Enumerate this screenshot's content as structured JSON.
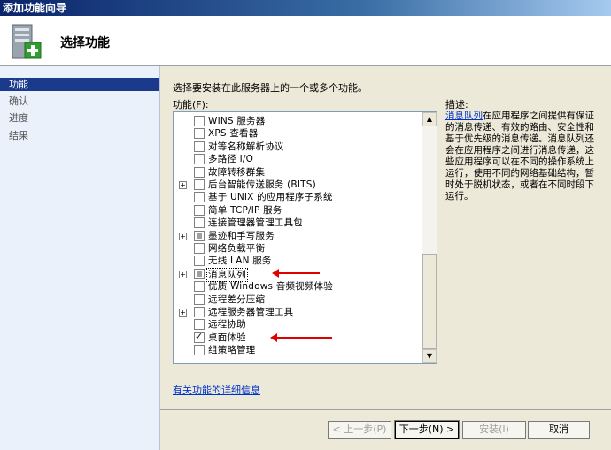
{
  "window": {
    "title": "添加功能向导"
  },
  "header": {
    "title": "选择功能"
  },
  "nav": {
    "items": [
      "功能",
      "确认",
      "进度",
      "结果"
    ]
  },
  "main": {
    "instruction": "选择要安装在此服务器上的一个或多个功能。",
    "features_label": "功能(F):",
    "features": [
      {
        "label": "WINS 服务器",
        "expander": "",
        "check": "none"
      },
      {
        "label": "XPS 查看器",
        "expander": "",
        "check": "none"
      },
      {
        "label": "对等名称解析协议",
        "expander": "",
        "check": "none"
      },
      {
        "label": "多路径 I/O",
        "expander": "",
        "check": "none"
      },
      {
        "label": "故障转移群集",
        "expander": "",
        "check": "none"
      },
      {
        "label": "后台智能传送服务 (BITS)",
        "expander": "+",
        "check": "none"
      },
      {
        "label": "基于 UNIX 的应用程序子系统",
        "expander": "",
        "check": "none"
      },
      {
        "label": "简单 TCP/IP 服务",
        "expander": "",
        "check": "none"
      },
      {
        "label": "连接管理器管理工具包",
        "expander": "",
        "check": "none"
      },
      {
        "label": "墨迹和手写服务",
        "expander": "+",
        "check": "partial"
      },
      {
        "label": "网络负载平衡",
        "expander": "",
        "check": "none"
      },
      {
        "label": "无线 LAN 服务",
        "expander": "",
        "check": "none"
      },
      {
        "label": "消息队列",
        "expander": "+",
        "check": "partial"
      },
      {
        "label": "优质 Windows 音频视频体验",
        "expander": "",
        "check": "none"
      },
      {
        "label": "远程差分压缩",
        "expander": "",
        "check": "none"
      },
      {
        "label": "远程服务器管理工具",
        "expander": "+",
        "check": "none"
      },
      {
        "label": "远程协助",
        "expander": "",
        "check": "none"
      },
      {
        "label": "桌面体验",
        "expander": "",
        "check": "checked"
      },
      {
        "label": "组策略管理",
        "expander": "",
        "check": "none"
      }
    ],
    "description_label": "描述:",
    "description_link": "消息队列",
    "description_text": "在应用程序之间提供有保证的消息传递、有效的路由、安全性和基于优先级的消息传递。消息队列还会在应用程序之间进行消息传递，这些应用程序可以在不同的操作系统上运行，使用不同的网络基础结构，暂时处于脱机状态，或者在不同时段下运行。",
    "more_info_link": "有关功能的详细信息"
  },
  "footer": {
    "back": "< 上一步(P)",
    "next": "下一步(N) >",
    "install": "安装(I)",
    "cancel": "取消"
  },
  "colors": {
    "annotation_arrow": "#e00000",
    "nav_selected": "#1c3a8c",
    "link": "#0033cc"
  }
}
